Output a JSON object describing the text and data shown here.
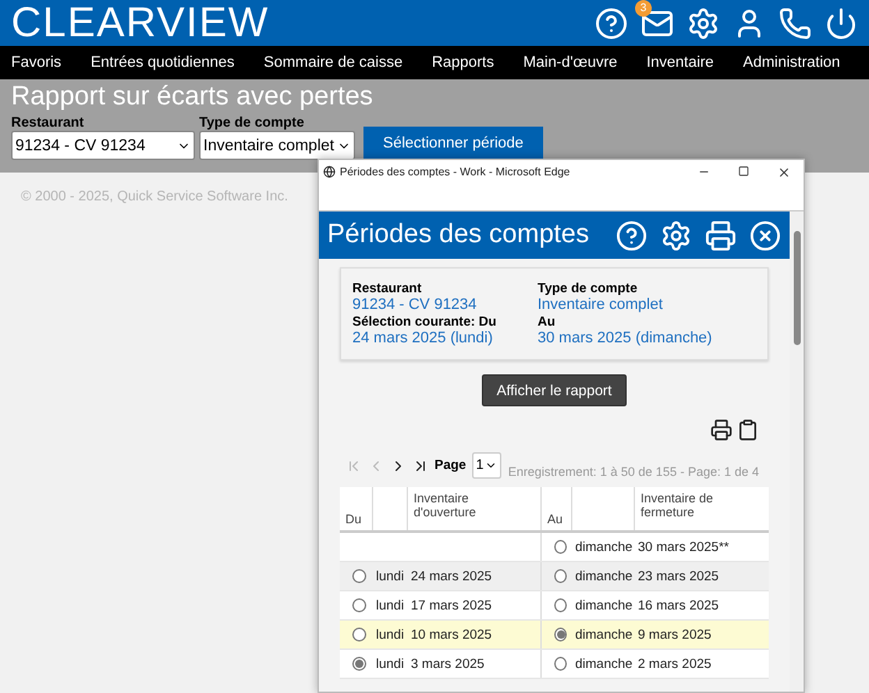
{
  "header": {
    "logo": "CLEARVIEW",
    "mail_badge": "3"
  },
  "nav": [
    "Favoris",
    "Entrées quotidiennes",
    "Sommaire de caisse",
    "Rapports",
    "Main-d'œuvre",
    "Inventaire",
    "Administration"
  ],
  "page": {
    "title": "Rapport sur écarts avec pertes",
    "fields": [
      {
        "label": "Restaurant",
        "value": "91234 - CV 91234"
      },
      {
        "label": "Type de compte",
        "value": "Inventaire complet"
      }
    ],
    "button": "Sélectionner période"
  },
  "footer": "© 2000 - 2025, Quick Service Software Inc.",
  "popup": {
    "window_title": "Périodes des comptes - Work - Microsoft Edge",
    "title": "Périodes des comptes",
    "info": [
      {
        "label": "Restaurant",
        "value": "91234 - CV 91234"
      },
      {
        "label": "Type de compte",
        "value": "Inventaire complet"
      },
      {
        "label": "Sélection courante: Du",
        "value": "24 mars 2025 (lundi)"
      },
      {
        "label": "Au",
        "value": "30 mars 2025 (dimanche)"
      }
    ],
    "report_button": "Afficher le rapport",
    "pager": {
      "label": "Page",
      "value": "1",
      "records": "Enregistrement: 1 à 50 de 155 - Page: 1 de 4"
    },
    "columns": [
      "Du",
      "Inventaire d'ouverture",
      "Au",
      "Inventaire de fermeture"
    ],
    "rows": [
      {
        "close_day": "dimanche",
        "close_date": "30 mars 2025**",
        "au_selected": false,
        "hovered": false,
        "selected": false
      },
      {
        "open_day": "lundi",
        "open_date": "24 mars 2025",
        "du_selected": false,
        "close_day": "dimanche",
        "close_date": "23 mars 2025",
        "au_selected": false,
        "hovered": true,
        "selected": false
      },
      {
        "open_day": "lundi",
        "open_date": "17 mars 2025",
        "du_selected": false,
        "close_day": "dimanche",
        "close_date": "16 mars 2025",
        "au_selected": false,
        "hovered": false,
        "selected": false
      },
      {
        "open_day": "lundi",
        "open_date": "10 mars 2025",
        "du_selected": false,
        "close_day": "dimanche",
        "close_date": "9 mars 2025",
        "au_selected": true,
        "hovered": false,
        "selected": true
      },
      {
        "open_day": "lundi",
        "open_date": "3 mars 2025",
        "du_selected": true,
        "close_day": "dimanche",
        "close_date": "2 mars 2025",
        "au_selected": false,
        "hovered": false,
        "selected": false
      }
    ]
  }
}
